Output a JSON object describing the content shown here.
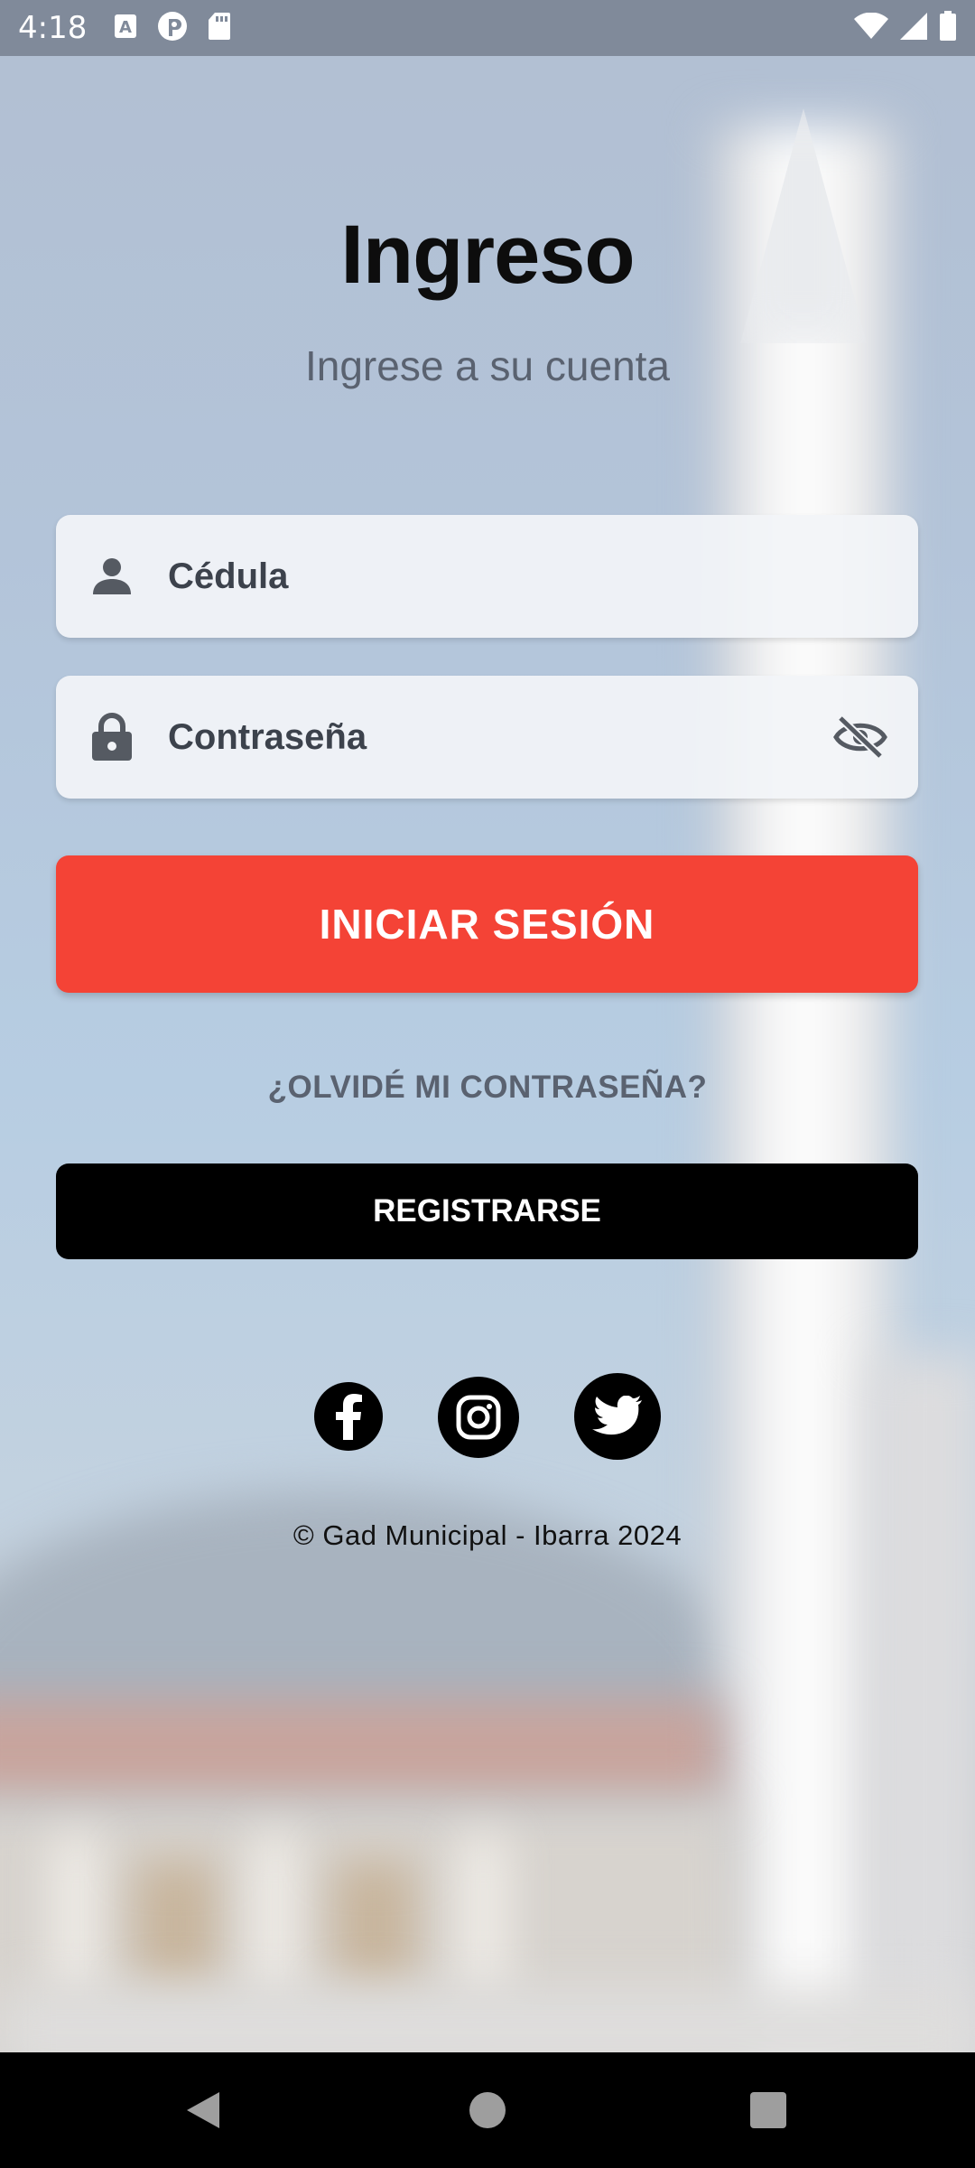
{
  "status_bar": {
    "time": "4:18",
    "notification_icons": [
      "font-a-icon",
      "pinterest-icon",
      "sd-card-icon"
    ],
    "system_icons": [
      "wifi-icon",
      "cell-signal-icon",
      "battery-icon"
    ]
  },
  "login": {
    "title": "Ingreso",
    "subtitle": "Ingrese a su cuenta",
    "cedula_label": "Cédula",
    "password_label": "Contraseña",
    "login_button": "INICIAR SESIÓN",
    "forgot_password": "¿OLVIDÉ MI CONTRASEÑA?",
    "register_button": "REGISTRARSE"
  },
  "social": [
    "facebook-icon",
    "instagram-icon",
    "twitter-icon"
  ],
  "footer": "© Gad Municipal - Ibarra 2024",
  "colors": {
    "primary_button": "#f44336",
    "register_button": "#000000",
    "muted_text": "#5a6270",
    "field_background": "#f2f4f7"
  },
  "nav_bar": [
    "back-button",
    "home-button",
    "recents-button"
  ]
}
